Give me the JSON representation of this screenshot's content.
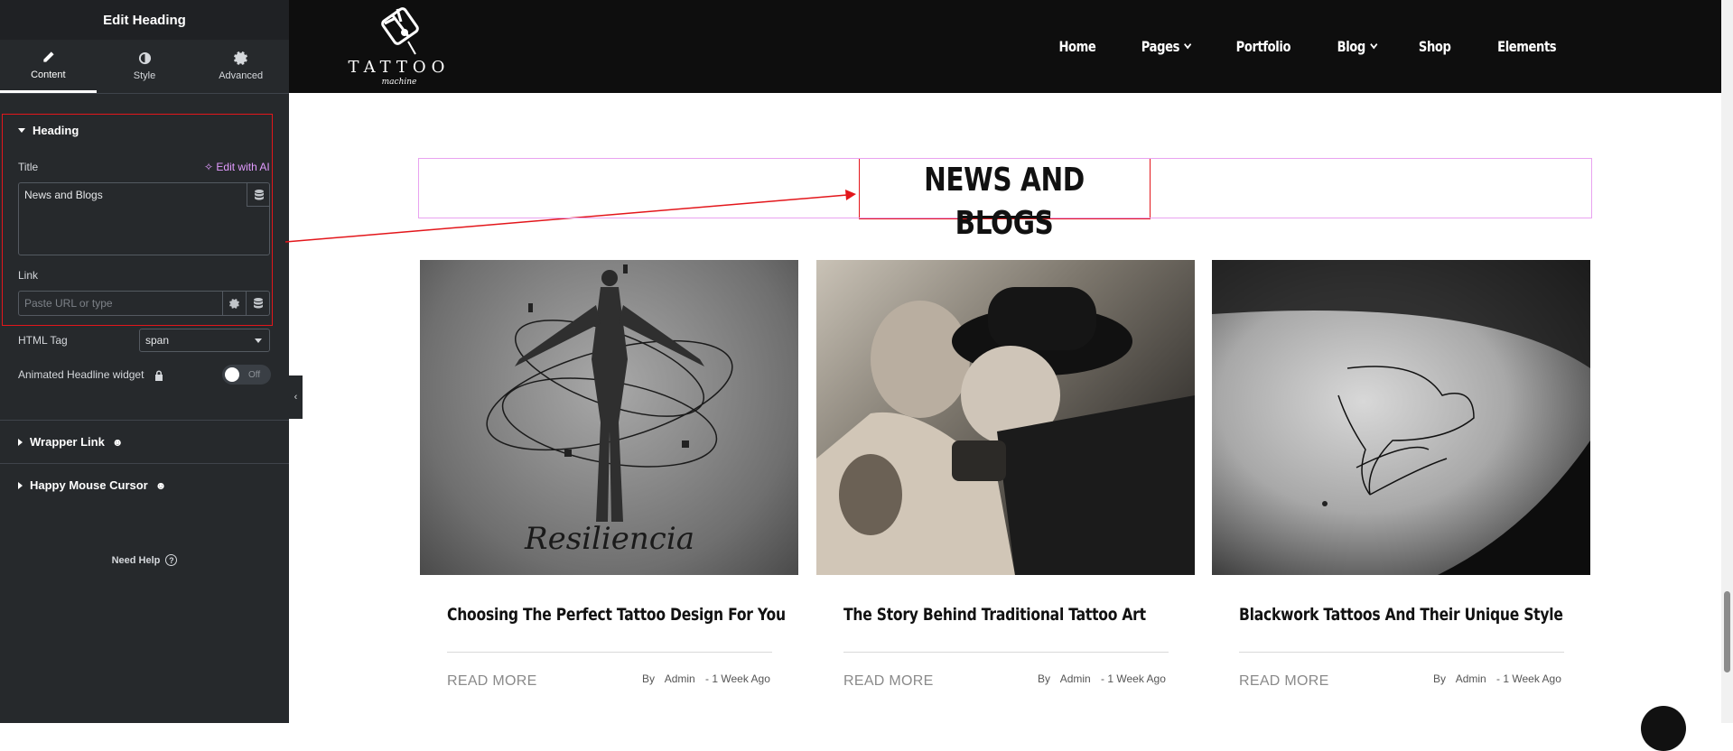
{
  "panel": {
    "header_title": "Edit Heading",
    "tabs": [
      {
        "label": "Content",
        "icon": "pencil-icon"
      },
      {
        "label": "Style",
        "icon": "half-circle-icon"
      },
      {
        "label": "Advanced",
        "icon": "gear-icon"
      }
    ],
    "heading_section": {
      "title": "Heading",
      "title_label": "Title",
      "edit_ai_label": "Edit with AI",
      "title_value": "News and Blogs",
      "link_label": "Link",
      "link_placeholder": "Paste URL or type",
      "html_tag_label": "HTML Tag",
      "html_tag_value": "span",
      "animated_label": "Animated Headline widget",
      "toggle_text": "Off"
    },
    "wrapper_link_title": "Wrapper Link",
    "happy_cursor_title": "Happy Mouse Cursor",
    "need_help": "Need Help"
  },
  "site": {
    "logo_text": "TATTOO",
    "logo_sub": "machine",
    "nav": [
      {
        "label": "Home",
        "has_dropdown": false
      },
      {
        "label": "Pages",
        "has_dropdown": true
      },
      {
        "label": "Portfolio",
        "has_dropdown": false
      },
      {
        "label": "Blog",
        "has_dropdown": true
      },
      {
        "label": "Shop",
        "has_dropdown": false
      },
      {
        "label": "Elements",
        "has_dropdown": false
      }
    ],
    "section_heading": "NEWS AND BLOGS",
    "posts": [
      {
        "title": "Choosing The Perfect Tattoo Design For You",
        "read_more": "READ MORE",
        "by": "By",
        "author": "Admin",
        "date": "- 1 Week Ago",
        "image": "tattoo-resiliencia-image",
        "image_text": "Resiliencia"
      },
      {
        "title": "The Story Behind Traditional Tattoo Art",
        "read_more": "READ MORE",
        "by": "By",
        "author": "Admin",
        "date": "- 1 Week Ago",
        "image": "tattoo-artist-photo"
      },
      {
        "title": "Blackwork Tattoos And Their Unique Style",
        "read_more": "READ MORE",
        "by": "By",
        "author": "Admin",
        "date": "- 1 Week Ago",
        "image": "bird-tattoo-image"
      }
    ]
  },
  "colors": {
    "panel_bg": "#26292c",
    "accent_ai": "#e29bff",
    "highlight_red": "#e3161b",
    "header_bg": "#0e0e0e"
  }
}
